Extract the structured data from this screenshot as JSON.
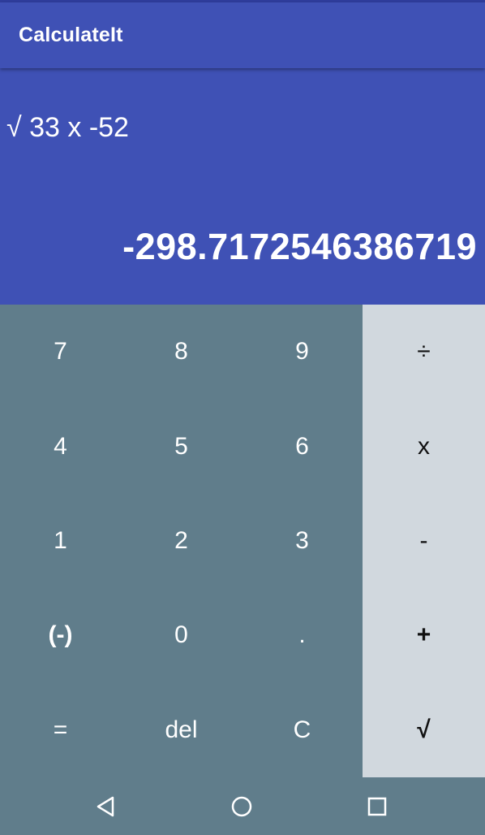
{
  "app": {
    "title": "CalculateIt"
  },
  "display": {
    "expression": "√ 33 x -52",
    "result": "-298.7172546386719"
  },
  "keypad": {
    "rows": [
      [
        "7",
        "8",
        "9"
      ],
      [
        "4",
        "5",
        "6"
      ],
      [
        "1",
        "2",
        "3"
      ],
      [
        "(-)",
        "0",
        "."
      ],
      [
        "=",
        "del",
        "C"
      ]
    ]
  },
  "operators": [
    "÷",
    "x",
    "-",
    "+",
    "√"
  ],
  "navbar": {
    "icons": [
      "back-triangle-icon",
      "home-circle-icon",
      "recents-square-icon"
    ]
  },
  "colors": {
    "primary": "#3f51b5",
    "primary_dark": "#2f3d9c",
    "keypad": "#607d8b",
    "operators": "#d1d8de"
  }
}
